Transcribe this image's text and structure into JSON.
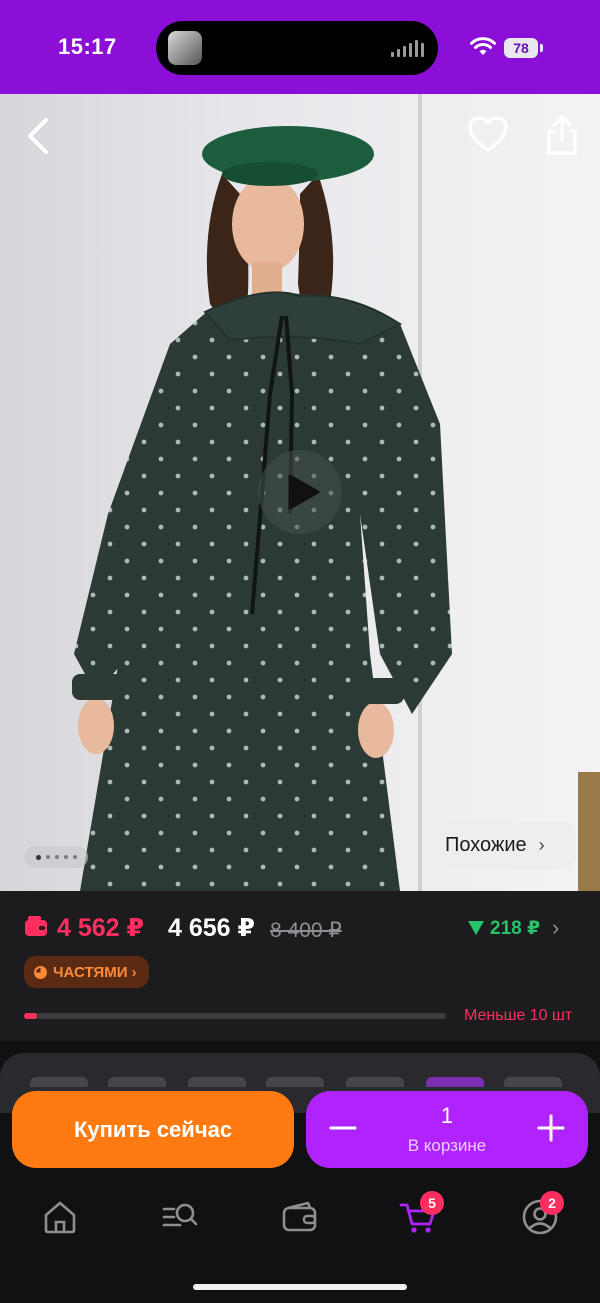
{
  "status_bar": {
    "time": "15:17",
    "battery": "78",
    "icons": [
      "island-avatar",
      "signal-bars-icon",
      "wifi-icon",
      "battery-icon"
    ]
  },
  "product_header": {
    "icons": [
      "chevron-left-icon",
      "heart-icon",
      "share-icon",
      "play-icon"
    ],
    "similar_label": "Похожие",
    "similar_chevron": "›",
    "gallery_dots_count": 5,
    "gallery_active_index": 0
  },
  "price": {
    "wallet_price": "4 562 ₽",
    "price": "4 656 ₽",
    "old_price": "8 400 ₽",
    "price_drop": "218 ₽",
    "drop_chevron": "›",
    "installments_label": "ЧАСТЯМИ ›",
    "stock_text": "Меньше 10 шт",
    "stock_level": 0.03
  },
  "actions": {
    "buy_now_label": "Купить сейчас",
    "cart_quantity": "1",
    "cart_label": "В корзине"
  },
  "tab_bar": {
    "items": [
      {
        "name": "home",
        "icon": "home-icon"
      },
      {
        "name": "catalog",
        "icon": "search-list-icon"
      },
      {
        "name": "wallet",
        "icon": "wallet-icon"
      },
      {
        "name": "cart",
        "icon": "cart-icon",
        "badge": "5",
        "active": true
      },
      {
        "name": "profile",
        "icon": "profile-icon",
        "badge": "2"
      }
    ]
  },
  "colors": {
    "status_bar_bg": "#8b0fd6",
    "wallet_price": "#ff2e5e",
    "price_drop": "#27c26b",
    "buy_button": "#ff7b12",
    "cart_control": "#b023ff",
    "active_tab": "#b023ff"
  }
}
